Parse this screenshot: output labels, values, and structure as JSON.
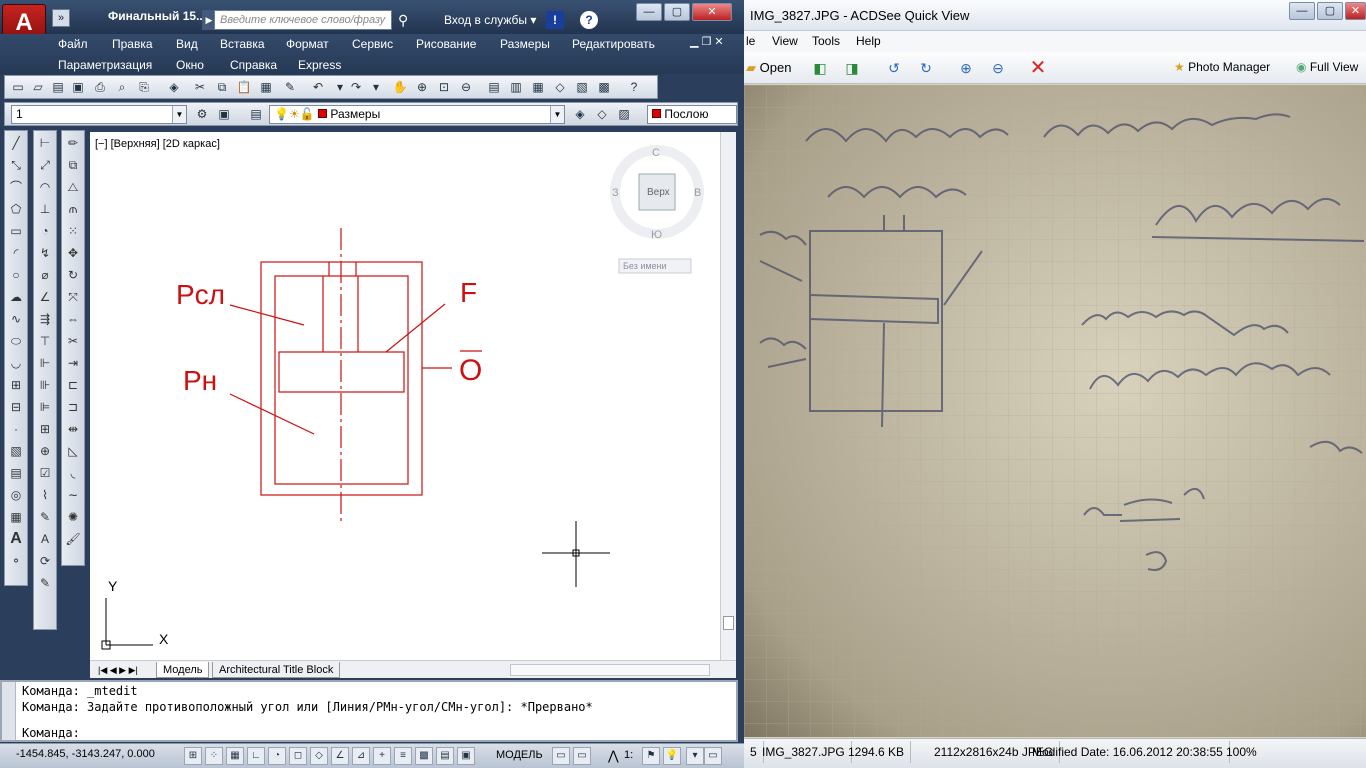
{
  "acad": {
    "doc_title": "Финальный 15...",
    "search_placeholder": "Введите ключевое слово/фразу",
    "services": "Вход в службы",
    "menu_row1": [
      "Файл",
      "Правка",
      "Вид",
      "Вставка",
      "Формат",
      "Сервис",
      "Рисование",
      "Размеры",
      "Редактировать"
    ],
    "menu_row2": [
      "Параметризация",
      "Окно",
      "Справка",
      "Express"
    ],
    "layer_combo": "1",
    "layer_name": "Размеры",
    "color_combo": "Послою",
    "viewport_label": "[−] [Верхняя] [2D каркас]",
    "viewcube": {
      "north": "С",
      "south": "Ю",
      "west": "З",
      "east": "В",
      "face": "Верх",
      "ucs": "Без имени"
    },
    "drawing_labels": {
      "p_sl": "Рсл",
      "p_n": "Рн",
      "f": "F",
      "o": "О"
    },
    "ucs_axes": {
      "x": "X",
      "y": "Y"
    },
    "tabs": [
      "Модель",
      "Architectural Title Block"
    ],
    "cmd_history": [
      "Команда:  _mtedit",
      "Команда: Задайте противоположный угол или [Линия/РМн-угол/СМн-угол]: *Прервано*"
    ],
    "cmd_prompt": "Команда:",
    "coords": "-1454.845, -3143.247, 0.000",
    "model_label": "МОДЕЛЬ",
    "scale_label": "1:"
  },
  "acdsee": {
    "title": "IMG_3827.JPG - ACDSee Quick View",
    "menus": [
      "le",
      "View",
      "Tools",
      "Help"
    ],
    "open": "Open",
    "photo_manager": "Photo Manager",
    "full_view": "Full View",
    "status": {
      "index": "5",
      "file": "IMG_3827.JPG",
      "size": "1294.6 KB",
      "dims": "2112x2816x24b JPEG",
      "modified": "Modified Date: 16.06.2012 20:38:55",
      "zoom": "100%"
    }
  },
  "colors": {
    "drawing_red": "#cc1111",
    "acad_frame": "#2b3f5c",
    "delete_red": "#dd2222"
  }
}
